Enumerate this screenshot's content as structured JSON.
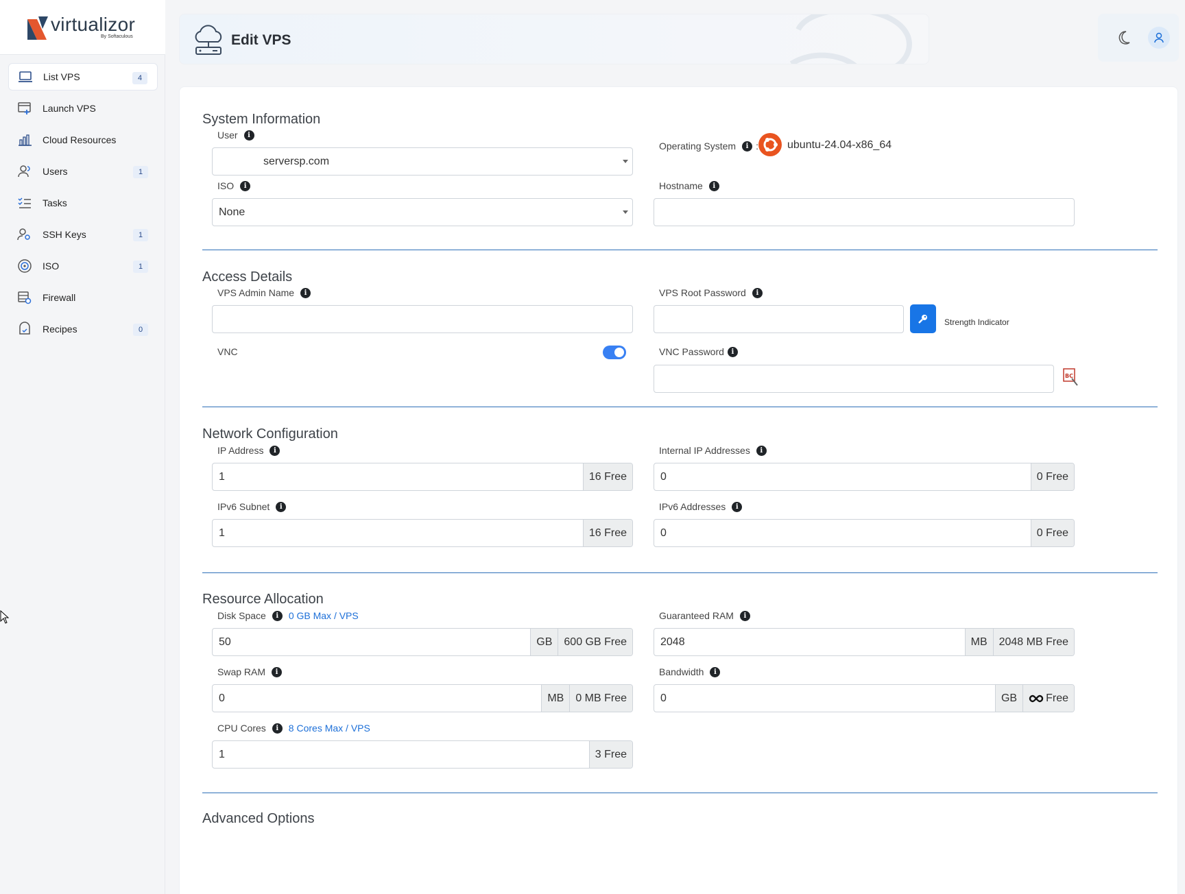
{
  "brand": {
    "name": "virtualizor",
    "sub": "By Softaculous"
  },
  "sidebar": {
    "items": [
      {
        "label": "List VPS",
        "badge": "4",
        "icon": "laptop-icon",
        "active": true
      },
      {
        "label": "Launch VPS",
        "badge": "",
        "icon": "add-window-icon"
      },
      {
        "label": "Cloud Resources",
        "badge": "",
        "icon": "bar-chart-icon"
      },
      {
        "label": "Users",
        "badge": "1",
        "icon": "users-icon"
      },
      {
        "label": "Tasks",
        "badge": "",
        "icon": "task-list-icon"
      },
      {
        "label": "SSH Keys",
        "badge": "1",
        "icon": "user-key-icon"
      },
      {
        "label": "ISO",
        "badge": "1",
        "icon": "disc-icon"
      },
      {
        "label": "Firewall",
        "badge": "",
        "icon": "firewall-icon"
      },
      {
        "label": "Recipes",
        "badge": "0",
        "icon": "recipe-icon"
      }
    ]
  },
  "header": {
    "title": "Edit VPS",
    "icon": "cloud-server-icon"
  },
  "top_right": {
    "theme_icon": "moon-icon",
    "user_icon": "user-icon"
  },
  "system_info": {
    "title": "System Information",
    "user_label": "User",
    "user_value": "serversp.com",
    "iso_label": "ISO",
    "iso_value": "None",
    "os_label": "Operating System",
    "os_colon": ":",
    "os_value": "ubuntu-24.04-x86_64",
    "hostname_label": "Hostname",
    "hostname_value": ""
  },
  "access": {
    "title": "Access Details",
    "admin_name_label": "VPS Admin Name",
    "admin_name_value": "",
    "root_pw_label": "VPS Root Password",
    "root_pw_value": "",
    "strength_label": "Strength Indicator",
    "vnc_label": "VNC",
    "vnc_enabled": true,
    "vnc_pw_label": "VNC Password",
    "vnc_pw_value": ""
  },
  "network": {
    "title": "Network Configuration",
    "ip_label": "IP Address",
    "ip_value": "1",
    "ip_free": "16 Free",
    "internal_label": "Internal IP Addresses",
    "internal_value": "0",
    "internal_free": "0 Free",
    "ipv6_subnet_label": "IPv6 Subnet",
    "ipv6_subnet_value": "1",
    "ipv6_subnet_free": "16 Free",
    "ipv6_addr_label": "IPv6 Addresses",
    "ipv6_addr_value": "0",
    "ipv6_addr_free": "0 Free"
  },
  "resources": {
    "title": "Resource Allocation",
    "disk_label": "Disk Space",
    "disk_link": "0 GB Max / VPS",
    "disk_value": "50",
    "disk_unit": "GB",
    "disk_free": "600 GB Free",
    "ram_label": "Guaranteed RAM",
    "ram_value": "2048",
    "ram_unit": "MB",
    "ram_free": "2048 MB Free",
    "swap_label": "Swap RAM",
    "swap_value": "0",
    "swap_unit": "MB",
    "swap_free": "0 MB Free",
    "bw_label": "Bandwidth",
    "bw_value": "0",
    "bw_unit": "GB",
    "bw_free": "Free",
    "cpu_label": "CPU Cores",
    "cpu_link": "8 Cores Max / VPS",
    "cpu_value": "1",
    "cpu_free": "3 Free"
  },
  "advanced": {
    "title": "Advanced Options"
  },
  "info_glyph": "i"
}
